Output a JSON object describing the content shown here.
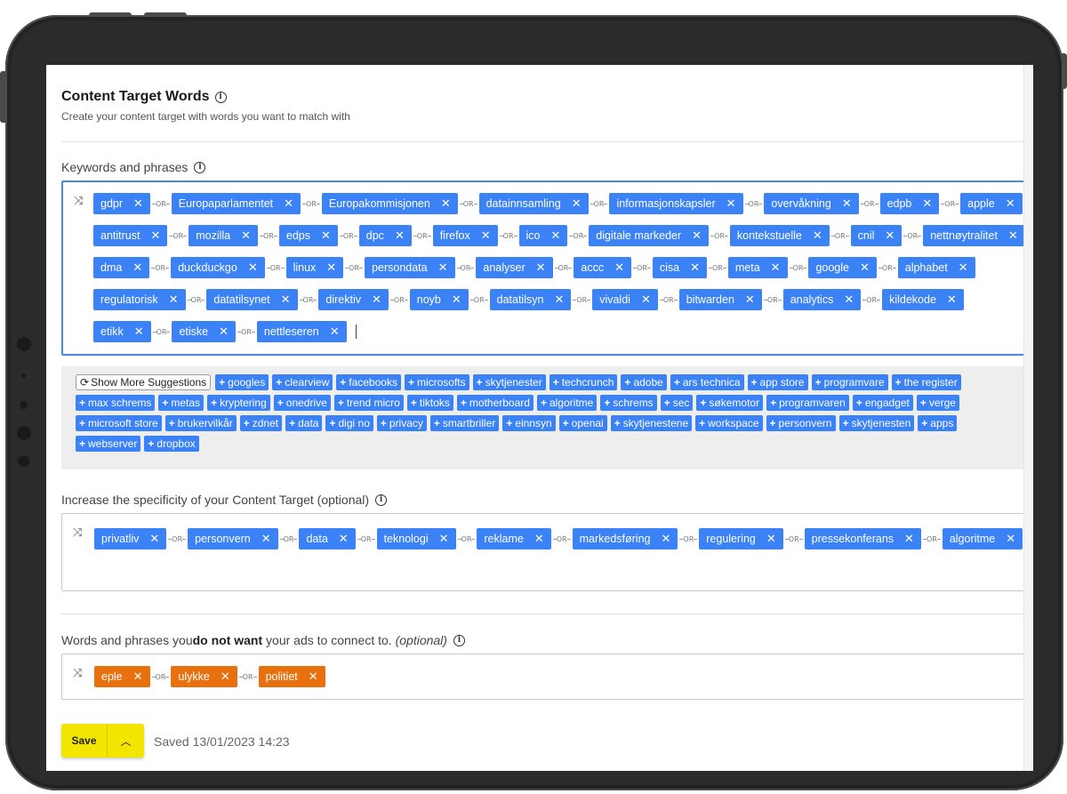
{
  "header": {
    "title": "Content Target Words",
    "subtitle": "Create your content target with words you want to match with"
  },
  "keywords": {
    "label": "Keywords and phrases",
    "rows": [
      [
        "gdpr",
        "Europaparlamentet",
        "Europakommisjonen",
        "datainnsamling",
        "informasjonskapsler",
        "overvåkning",
        "edpb",
        "apple"
      ],
      [
        "antitrust",
        "mozilla",
        "edps",
        "dpc",
        "firefox",
        "ico",
        "digitale markeder",
        "kontekstuelle",
        "cnil",
        "nettnøytralitet"
      ],
      [
        "dma",
        "duckduckgo",
        "linux",
        "persondata",
        "analyser",
        "accc",
        "cisa",
        "meta",
        "google",
        "alphabet"
      ],
      [
        "regulatorisk",
        "datatilsynet",
        "direktiv",
        "noyb",
        "datatilsyn",
        "vivaldi",
        "bitwarden",
        "analytics",
        "kildekode"
      ],
      [
        "etikk",
        "etiske",
        "nettleseren"
      ]
    ]
  },
  "connector": "OR",
  "remove_glyph": "✕",
  "suggestions": {
    "show_more_label": "Show More Suggestions",
    "rows": [
      [
        "googles",
        "clearview",
        "facebooks",
        "microsofts",
        "skytjenester",
        "techcrunch",
        "adobe",
        "ars technica",
        "app store",
        "programvare",
        "the register"
      ],
      [
        "max schrems",
        "metas",
        "kryptering",
        "onedrive",
        "trend micro",
        "tiktoks",
        "motherboard",
        "algoritme",
        "schrems",
        "sec",
        "søkemotor",
        "programvaren",
        "engadget",
        "verge"
      ],
      [
        "microsoft store",
        "brukervilkår",
        "zdnet",
        "data",
        "digi no",
        "privacy",
        "smartbriller",
        "einnsyn",
        "openai",
        "skytjenestene",
        "workspace",
        "personvern",
        "skytjenesten",
        "apps"
      ],
      [
        "webserver",
        "dropbox"
      ]
    ]
  },
  "specificity": {
    "label": "Increase the specificity of your Content Target (optional)",
    "tags": [
      "privatliv",
      "personvern",
      "data",
      "teknologi",
      "reklame",
      "markedsføring",
      "regulering",
      "pressekonferans",
      "algoritme"
    ]
  },
  "exclude": {
    "label_pre": "Words and phrases you ",
    "label_bold": "do not want",
    "label_post": " your ads to connect to. ",
    "label_optional": "(optional)",
    "tags": [
      "eple",
      "ulykke",
      "politiet"
    ]
  },
  "footer": {
    "save_label": "Save",
    "saved_text": "Saved 13/01/2023 14:23"
  },
  "icons": {
    "shuffle": "shuffle-icon",
    "info": "info-icon",
    "refresh": "refresh-icon",
    "chevron": "chevron-up-icon"
  },
  "colors": {
    "tag_blue": "#3b82f6",
    "tag_orange": "#e8700f",
    "save_yellow": "#f2e600",
    "focus_border": "#4a86e8"
  }
}
